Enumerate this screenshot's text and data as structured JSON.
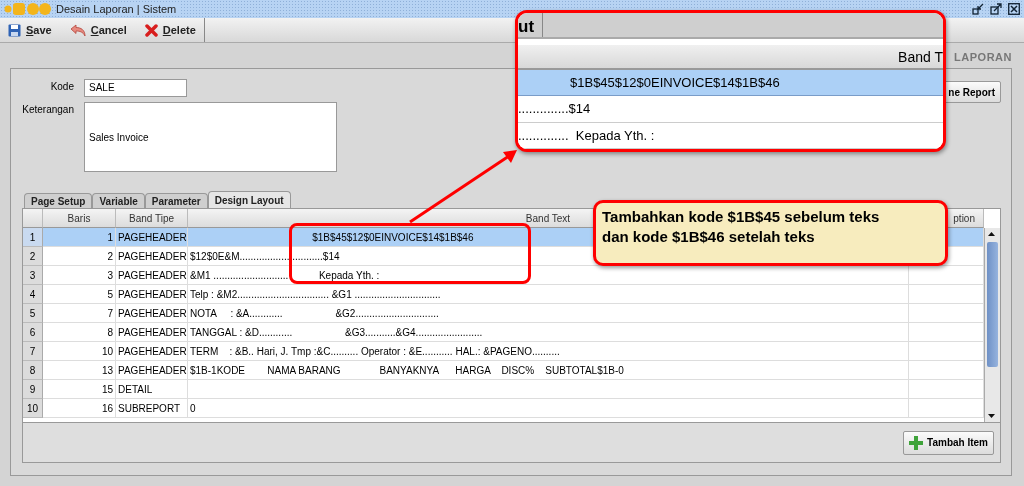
{
  "window": {
    "title": "Desain Laporan | Sistem"
  },
  "toolbar": [
    {
      "kind": "save",
      "label": "Save"
    },
    {
      "kind": "cancel",
      "label": "Cancel"
    },
    {
      "kind": "delete",
      "label": "Delete"
    }
  ],
  "section_title": "LAPORAN",
  "form": {
    "kode_label": "Kode",
    "kode_value": "SALE",
    "keterangan_label": "Keterangan",
    "keterangan_value": "Sales Invoice",
    "clone_button": "ne Report"
  },
  "tabs": [
    {
      "label": "Page Setup",
      "selected": false
    },
    {
      "label": "Variable",
      "selected": false
    },
    {
      "label": "Parameter",
      "selected": false
    },
    {
      "label": "Design Layout",
      "selected": true
    }
  ],
  "table": {
    "columns": [
      "Baris",
      "Band Tipe",
      "Band Text",
      "ption"
    ],
    "rows": [
      {
        "row": "1",
        "baris": "1",
        "band_tipe": "PAGEHEADER",
        "band_text": "                                            $1B$45$12$0EINVOICE$14$1B$46",
        "selected": true
      },
      {
        "row": "2",
        "baris": "2",
        "band_tipe": "PAGEHEADER",
        "band_text": "$12$0E&M..............................$14",
        "selected": false
      },
      {
        "row": "3",
        "baris": "3",
        "band_tipe": "PAGEHEADER",
        "band_text": "&M1 ...........................           Kepada Yth. :",
        "selected": false
      },
      {
        "row": "4",
        "baris": "5",
        "band_tipe": "PAGEHEADER",
        "band_text": "Telp : &M2................................. &G1 ...............................",
        "selected": false
      },
      {
        "row": "5",
        "baris": "7",
        "band_tipe": "PAGEHEADER",
        "band_text": "NOTA     : &A............                   &G2..............................",
        "selected": false
      },
      {
        "row": "6",
        "baris": "8",
        "band_tipe": "PAGEHEADER",
        "band_text": "TANGGAL : &D............                   &G3...........&G4........................",
        "selected": false
      },
      {
        "row": "7",
        "baris": "10",
        "band_tipe": "PAGEHEADER",
        "band_text": "TERM    : &B.. Hari, J. Tmp :&C.......... Operator : &E........... HAL.: &PAGENO..........",
        "selected": false
      },
      {
        "row": "8",
        "baris": "13",
        "band_tipe": "PAGEHEADER",
        "band_text": "$1B-1KODE        NAMA BARANG              BANYAKNYA      HARGA    DISC%    SUBTOTAL$1B-0",
        "selected": false
      },
      {
        "row": "9",
        "baris": "15",
        "band_tipe": "DETAIL",
        "selected": false
      },
      {
        "row": "10",
        "baris": "16",
        "band_tipe": "SUBREPORT",
        "band_text": "0",
        "selected": false
      }
    ]
  },
  "add_button": "Tambah Item",
  "callout": {
    "tab": "ut",
    "header": "Band T",
    "rows": [
      {
        "text": "$1B$45$12$0EINVOICE$14$1B$46",
        "selected": true
      },
      {
        "text": "..............$14",
        "selected": false
      },
      {
        "text": "..............  Kepada Yth. :",
        "selected": false
      }
    ]
  },
  "note": {
    "text": "Tambahkan kode $1B$45 sebelum teks dan kode $1B$46 setelah teks"
  }
}
